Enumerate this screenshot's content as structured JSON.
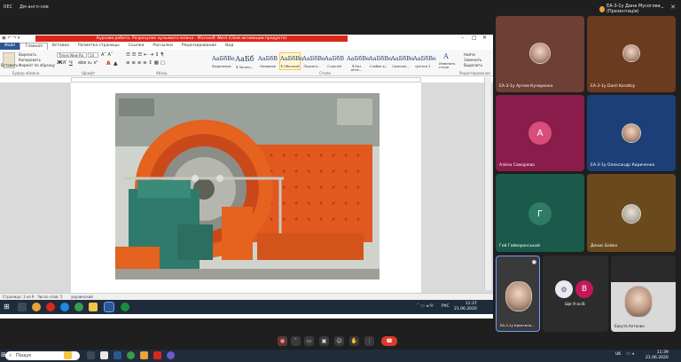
{
  "meeting": {
    "rec_label": "REC",
    "title": "Дм-англ-нов",
    "presenter": "ЕА-3-1у Дана Мусогова (Презентація)",
    "controls": [
      "mic-icon",
      "camera-icon",
      "share-icon",
      "emoji-icon",
      "hand-icon",
      "more-icon"
    ],
    "end_call_icon": "phone-end-icon"
  },
  "word": {
    "title": "Курсова робота. Розрахунок кульового млина - Microsoft Word (Сбой активации продукта)",
    "tabs": [
      "Файл",
      "Главная",
      "Вставка",
      "Разметка страницы",
      "Ссылки",
      "Рассылки",
      "Рецензирование",
      "Вид"
    ],
    "clipboard": {
      "paste": "Вставить",
      "cut": "Вырезать",
      "copy": "Копировать",
      "format": "Формат по образцу",
      "group": "Буфер обмена"
    },
    "font": {
      "name": "Times New Ro",
      "size": "14",
      "group": "Шрифт"
    },
    "paragraph_group": "Абзац",
    "styles": [
      {
        "sample": "AaБбВе",
        "name": "Выделение"
      },
      {
        "sample": "AaБб",
        "name": "¶ Заголо..."
      },
      {
        "sample": "AaБбВ",
        "name": "Название"
      },
      {
        "sample": "AaБбВе",
        "name": "¶ Обычный"
      },
      {
        "sample": "AaБбВе",
        "name": "Подзаго..."
      },
      {
        "sample": "AaБбВ",
        "name": "Строгий"
      },
      {
        "sample": "AaБбВе",
        "name": "¶ Без инте..."
      },
      {
        "sample": "AaБбВе",
        "name": "Слабое в..."
      },
      {
        "sample": "AaБбВе",
        "name": "Сильное..."
      },
      {
        "sample": "AaБбВе",
        "name": "Цитата 2"
      }
    ],
    "styles_group": "Стили",
    "change_styles": "Изменить стили",
    "editing": {
      "find": "Найти",
      "replace": "Заменить",
      "select": "Выделить",
      "group": "Редактирование"
    },
    "status": {
      "page": "Страница: 3 из 9",
      "words": "Число слов: 5",
      "lang": "украинский"
    }
  },
  "inner_taskbar": {
    "time": "11:37",
    "date": "21.06.2020",
    "lang": "РУС"
  },
  "participants": [
    {
      "name": "ЕА-3-1у Артем Кучеренко",
      "bg": "#6e3f34",
      "type": "face"
    },
    {
      "name": "ЕА-3-1у Danil Korotkiy",
      "bg": "#6b3a1f",
      "type": "face"
    },
    {
      "name": "Алёна Самарієва",
      "bg": "#8a1c4c",
      "type": "avatar",
      "initial": "А",
      "avatar_bg": "#d84d7a"
    },
    {
      "name": "ЕА-3-1у Олександр Кириченко",
      "bg": "#1d3f78",
      "type": "face"
    },
    {
      "name": "Гей Гайворонський",
      "bg": "#1b5a4a",
      "type": "avatar",
      "initial": "Г",
      "avatar_bg": "#2f7c65"
    },
    {
      "name": "Денис Бойко",
      "bg": "#6a4a1d",
      "type": "face"
    },
    {
      "name": "ЕА-3-1у Кристина...",
      "bg": "#3a3a3a",
      "type": "face"
    },
    {
      "name": "Ще 9 осіб",
      "bg": "#2c2c2c",
      "type": "group",
      "initial": "В",
      "avatar_bg": "#c2185b"
    },
    {
      "name": "Бакута Антонин",
      "bg": "#2a2a2a",
      "type": "face"
    }
  ],
  "host_taskbar": {
    "search_placeholder": "Пошук",
    "time": "11:39",
    "date": "21.06.2020",
    "lang": "UK"
  }
}
